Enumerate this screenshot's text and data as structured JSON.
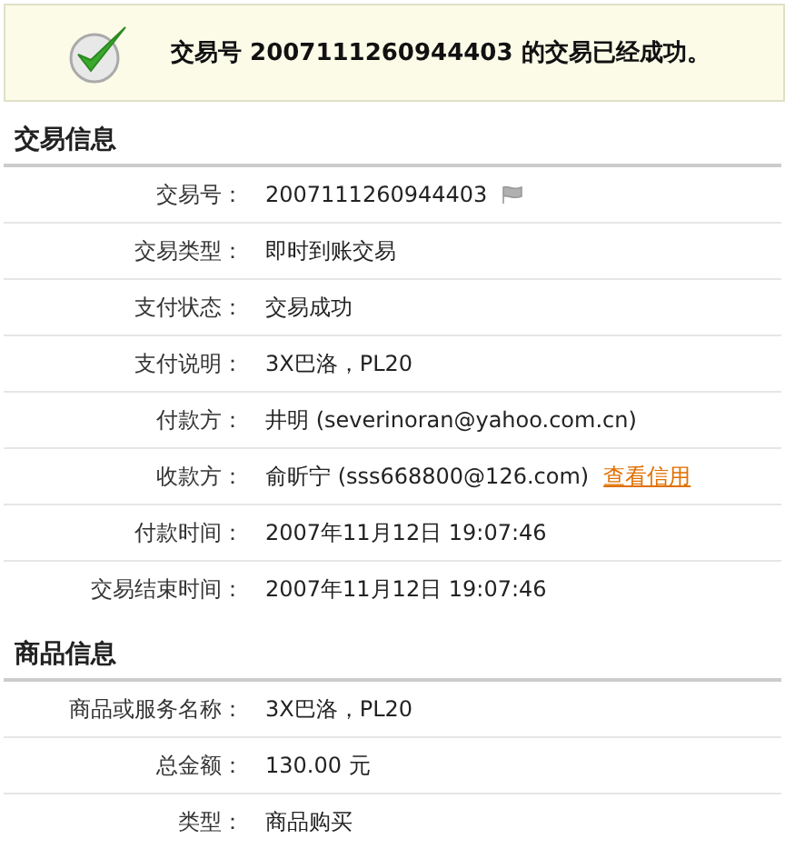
{
  "banner": {
    "message": "交易号 2007111260944403 的交易已经成功。"
  },
  "sections": [
    {
      "title": "交易信息",
      "rows": [
        {
          "label": "交易号：",
          "value": "2007111260944403",
          "kind": "flagged"
        },
        {
          "label": "交易类型：",
          "value": "即时到账交易",
          "kind": "plain"
        },
        {
          "label": "支付状态：",
          "value": "交易成功",
          "kind": "plain"
        },
        {
          "label": "支付说明：",
          "value": "3X巴洛，PL20",
          "kind": "plain"
        },
        {
          "label": "付款方：",
          "value": "井明 (severinoran@yahoo.com.cn)",
          "kind": "plain"
        },
        {
          "label": "收款方：",
          "value": "俞昕宁 (sss668800@126.com)",
          "kind": "link",
          "link": "查看信用"
        },
        {
          "label": "付款时间：",
          "value": "2007年11月12日 19:07:46",
          "kind": "plain"
        },
        {
          "label": "交易结束时间：",
          "value": "2007年11月12日 19:07:46",
          "kind": "plain"
        }
      ]
    },
    {
      "title": "商品信息",
      "rows": [
        {
          "label": "商品或服务名称：",
          "value": "3X巴洛，PL20",
          "kind": "plain"
        },
        {
          "label": "总金额：",
          "value": "130.00 元",
          "kind": "plain"
        },
        {
          "label": "类型：",
          "value": "商品购买",
          "kind": "plain"
        }
      ]
    }
  ]
}
